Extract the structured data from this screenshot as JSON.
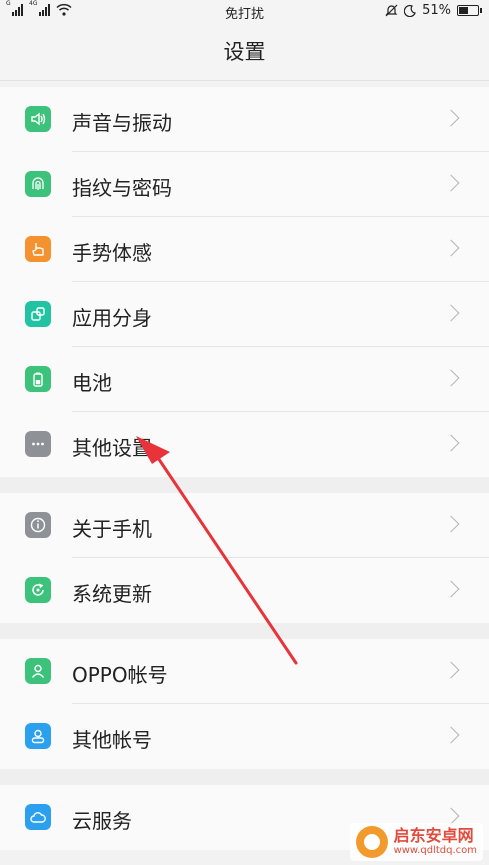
{
  "status_bar": {
    "signal_1": "G",
    "signal_2": "4G",
    "center_text": "免打扰",
    "battery_percent": "51%",
    "battery_level": 0.51
  },
  "title": "设置",
  "groups": [
    [
      {
        "label": "声音与振动",
        "icon": "sound-vibration-icon",
        "color": "#3cc27a"
      },
      {
        "label": "指纹与密码",
        "icon": "fingerprint-icon",
        "color": "#3cc27a"
      },
      {
        "label": "手势体感",
        "icon": "gesture-hand-icon",
        "color": "#f3922f"
      },
      {
        "label": "应用分身",
        "icon": "app-clone-icon",
        "color": "#21c3a3"
      },
      {
        "label": "电池",
        "icon": "battery-icon",
        "color": "#3cc27a"
      },
      {
        "label": "其他设置",
        "icon": "more-dots-icon",
        "color": "#8e9196"
      }
    ],
    [
      {
        "label": "关于手机",
        "icon": "info-icon",
        "color": "#8e9196"
      },
      {
        "label": "系统更新",
        "icon": "system-update-icon",
        "color": "#3cc27a"
      }
    ],
    [
      {
        "label": "OPPO帐号",
        "icon": "oppo-account-icon",
        "color": "#3cc27a"
      },
      {
        "label": "其他帐号",
        "icon": "other-account-icon",
        "color": "#2aa0ef"
      }
    ],
    [
      {
        "label": "云服务",
        "icon": "cloud-icon",
        "color": "#2aa0ef"
      }
    ]
  ],
  "watermark": {
    "name": "启东安卓网",
    "url": "www.qdltdq.com"
  },
  "annotation_color": "#e8333a"
}
